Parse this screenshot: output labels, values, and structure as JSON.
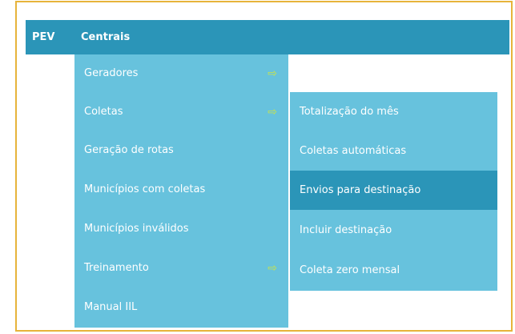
{
  "topbar": {
    "items": [
      {
        "label": "PEV"
      },
      {
        "label": "Centrais"
      }
    ]
  },
  "menu": {
    "items": [
      {
        "label": "Geradores",
        "has_submenu": true
      },
      {
        "label": "Coletas",
        "has_submenu": true
      },
      {
        "label": "Geração de rotas",
        "has_submenu": false
      },
      {
        "label": "Municípios com coletas",
        "has_submenu": false
      },
      {
        "label": "Municípios inválidos",
        "has_submenu": false
      },
      {
        "label": "Treinamento",
        "has_submenu": true
      },
      {
        "label": "Manual IIL",
        "has_submenu": false
      }
    ],
    "arrow_glyph": "⇨",
    "arrow_color": "#c9e44a"
  },
  "submenu": {
    "parent": "Coletas",
    "active_item": "Envios para destinação",
    "items": [
      {
        "label": "Totalização do mês"
      },
      {
        "label": "Coletas automáticas"
      },
      {
        "label": "Envios para destinação"
      },
      {
        "label": "Incluir destinação"
      },
      {
        "label": "Coleta zero mensal"
      }
    ]
  },
  "colors": {
    "bar": "#2b95b8",
    "menu": "#67c2dd",
    "frame": "#e7b43b",
    "active": "#2b95b8"
  }
}
